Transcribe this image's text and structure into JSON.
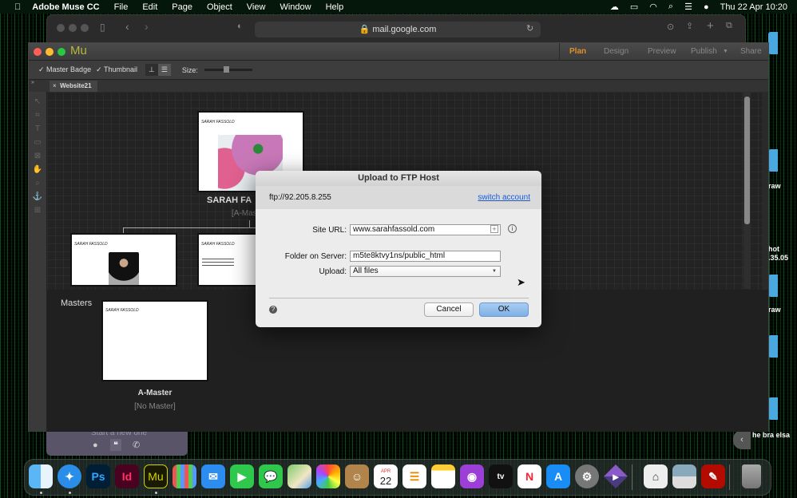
{
  "menubar": {
    "app": "Adobe Muse CC",
    "items": [
      "File",
      "Edit",
      "Page",
      "Object",
      "View",
      "Window",
      "Help"
    ],
    "datetime": "Thu 22 Apr  10:20"
  },
  "safari": {
    "address": "mail.google.com"
  },
  "muse": {
    "logo": "Mu",
    "modes": [
      "Plan",
      "Design",
      "Preview",
      "Publish",
      "Share"
    ],
    "active_mode": "Plan",
    "toolbar": {
      "master_badge": "Master Badge",
      "thumbnail": "Thumbnail",
      "size_label": "Size:",
      "size_value": 0.4
    },
    "tab": "Website21",
    "pages": {
      "home_title": "SARAH FA",
      "home_master": "[A-Mas",
      "thumb_header": "SARAH FASSOLD"
    },
    "masters": {
      "heading": "Masters",
      "name": "A-Master",
      "parent": "[No Master]"
    }
  },
  "dialog": {
    "title": "Upload to FTP Host",
    "host": "ftp://92.205.8.255",
    "switch_account": "switch account",
    "site_url_label": "Site URL:",
    "site_url": "www.sarahfassold.com",
    "folder_label": "Folder on Server:",
    "folder": "m5te8ktvy1ns/public_html",
    "upload_label": "Upload:",
    "upload": "All files",
    "cancel": "Cancel",
    "ok": "OK"
  },
  "chat": {
    "text": "Start a new one"
  },
  "desktop": {
    "labels": [
      "raw",
      "hot",
      ".35.05",
      "raw",
      "he bra elsa"
    ]
  },
  "dock": {
    "calendar_month": "APR",
    "calendar_day": "22",
    "apps": [
      "Finder",
      "Safari",
      "Photoshop",
      "InDesign",
      "Muse",
      "Launchpad",
      "Mail",
      "FaceTime",
      "Messages",
      "Maps",
      "Photos",
      "Contacts",
      "Calendar",
      "Reminders",
      "Notes",
      "Podcasts",
      "TV",
      "News",
      "App Store",
      "System Preferences",
      "App",
      "Scanner",
      "Preview",
      "Acrobat",
      "Trash"
    ],
    "labels": {
      "ps": "Ps",
      "id": "Id",
      "mu": "Mu",
      "tv": "tv"
    }
  },
  "colors": {
    "accent_plan": "#e0902a",
    "muse_logo": "#b8b83a",
    "link": "#1a5ad8",
    "ok_button": "#8fbbe9"
  }
}
